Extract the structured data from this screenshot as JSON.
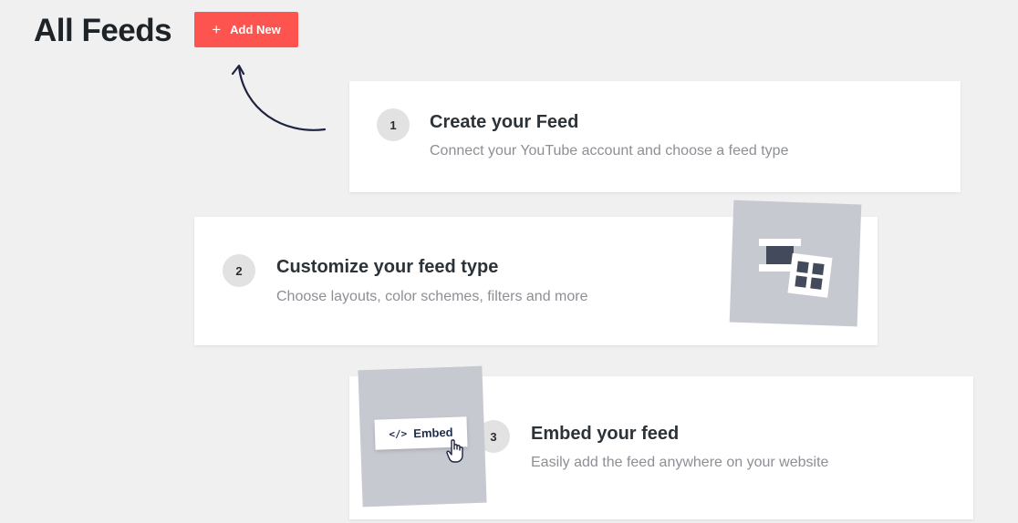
{
  "header": {
    "title": "All Feeds",
    "add_new_label": "Add New"
  },
  "steps": [
    {
      "number": "1",
      "title": "Create your Feed",
      "description": "Connect your YouTube account and choose a feed type"
    },
    {
      "number": "2",
      "title": "Customize your feed type",
      "description": "Choose layouts, color schemes, filters and more"
    },
    {
      "number": "3",
      "title": "Embed your feed",
      "description": "Easily add the feed anywhere on your website",
      "embed_label": "Embed"
    }
  ],
  "icons": {
    "plus": "plus-icon",
    "code": "code-icon",
    "cursor": "hand-cursor-icon",
    "arrow": "curved-arrow-icon",
    "layout": "layout-illustration-icon"
  },
  "colors": {
    "accent": "#fe544f",
    "background": "#f0f0f0",
    "card": "#ffffff",
    "illustration": "#c7c9d0",
    "step_circle": "#e2e2e2",
    "text_dark": "#1d2327",
    "text_muted": "#8c8f94",
    "navy": "#1e2d4a"
  }
}
